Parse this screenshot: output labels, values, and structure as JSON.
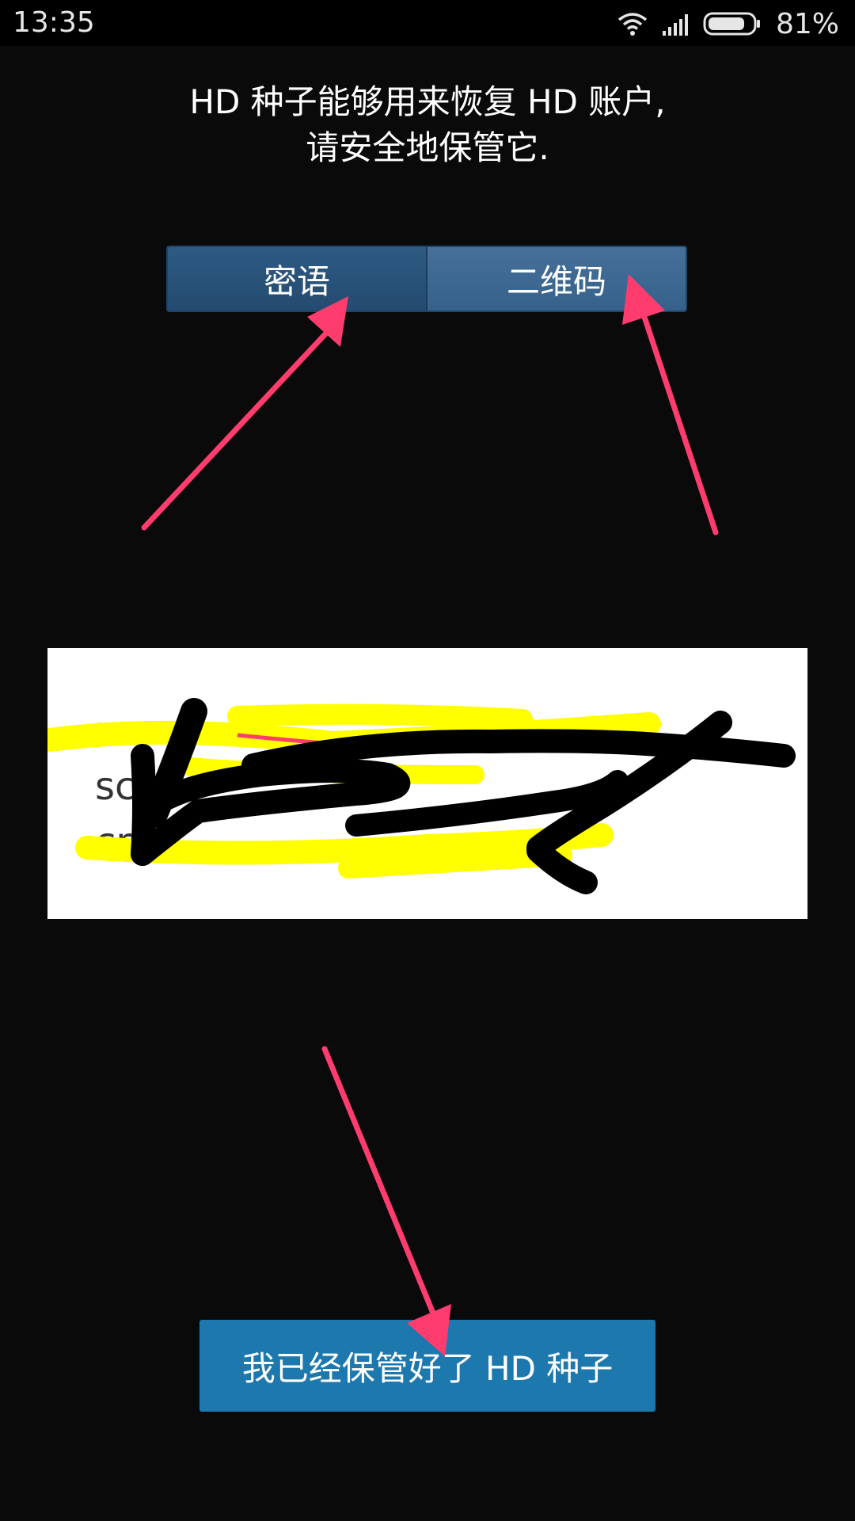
{
  "status_bar": {
    "time": "13:35",
    "battery_percent": "81%",
    "battery_level": 0.81,
    "icons": [
      "wifi-icon",
      "signal-icon",
      "battery-icon"
    ]
  },
  "message": {
    "line1": "HD 种子能够用来恢复 HD 账户,",
    "line2": "请安全地保管它."
  },
  "tabs": [
    {
      "label": "密语",
      "selected": true
    },
    {
      "label": "二维码",
      "selected": false
    }
  ],
  "seed_panel": {
    "visible_fragments": "n u  s\nsc  ur\ncr"
  },
  "confirm_button": {
    "label": "我已经保管好了 HD 种子"
  },
  "colors": {
    "background": "#0a0a0a",
    "tab_selected": "#244b70",
    "tab_unselected": "#3e6a94",
    "button": "#1d78ad",
    "arrow_annotation": "#ff3c6e",
    "highlight_annotation": "#ffff00",
    "redaction": "#000000"
  }
}
